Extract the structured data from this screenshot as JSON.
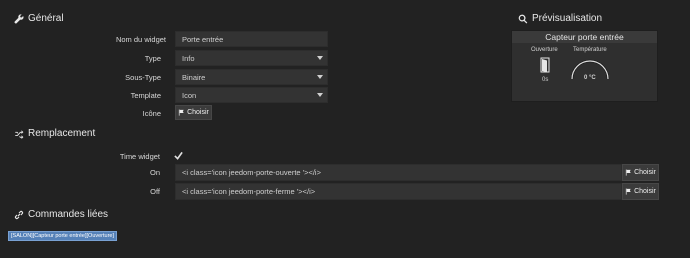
{
  "general": {
    "title": "Général",
    "icon": "wrench-icon",
    "fields": {
      "name_label": "Nom du widget",
      "name_value": "Porte entrée",
      "type_label": "Type",
      "type_value": "Info",
      "subtype_label": "Sous-Type",
      "subtype_value": "Binaire",
      "template_label": "Template",
      "template_value": "Icon",
      "icon_label": "Icône",
      "icon_button": "Choisir"
    }
  },
  "preview": {
    "title": "Prévisualisation",
    "icon": "search-icon",
    "widget_title": "Capteur porte entrée",
    "open_label": "Ouverture",
    "open_value": "0s",
    "temp_label": "Température",
    "temp_value": "0 °C"
  },
  "replacement": {
    "title": "Remplacement",
    "icon": "shuffle-icon",
    "time_widget_label": "Time widget",
    "time_widget_checked": true,
    "on_label": "On",
    "on_value": "<i class='icon jeedom-porte-ouverte '></i>",
    "on_button": "Choisir",
    "off_label": "Off",
    "off_value": "<i class='icon jeedom-porte-ferme '></i>",
    "off_button": "Choisir"
  },
  "linked": {
    "title": "Commandes liées",
    "icon": "link-icon",
    "tag": "[SALON][Capteur porte entrée][Ouverture]"
  },
  "colors": {
    "background": "#222222",
    "input_bg": "#333333",
    "tag_bg": "#5581b8"
  }
}
